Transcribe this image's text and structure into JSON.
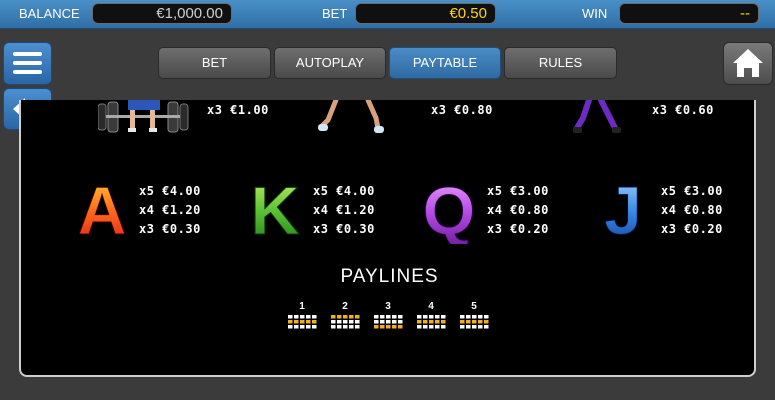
{
  "status_bar": {
    "balance_label": "BALANCE",
    "balance_value": "€1,000.00",
    "bet_label": "BET",
    "bet_value": "€0.50",
    "win_label": "WIN",
    "win_value": "--"
  },
  "tabs": [
    {
      "label": "BET",
      "active": false
    },
    {
      "label": "AUTOPLAY",
      "active": false
    },
    {
      "label": "PAYTABLE",
      "active": true
    },
    {
      "label": "RULES",
      "active": false
    }
  ],
  "icons": {
    "menu": "hamburger-menu-icon",
    "back": "arrow-left-icon",
    "home": "home-icon"
  },
  "paytable_top_row": [
    {
      "symbol": "weightlifter",
      "payout": "x3 €1.00"
    },
    {
      "symbol": "runner",
      "payout": "x3 €0.80"
    },
    {
      "symbol": "athlete-purple",
      "payout": "x3 €0.60"
    }
  ],
  "paytable_letters": [
    {
      "symbol": "A",
      "colors": [
        "#ffd23a",
        "#ff6a1a",
        "#e01818"
      ],
      "payouts": [
        "x5 €4.00",
        "x4 €1.20",
        "x3 €0.30"
      ]
    },
    {
      "symbol": "K",
      "colors": [
        "#c6f26a",
        "#5cc236",
        "#1f7a18"
      ],
      "payouts": [
        "x5 €4.00",
        "x4 €1.20",
        "x3 €0.30"
      ]
    },
    {
      "symbol": "Q",
      "colors": [
        "#f0a8ff",
        "#b64ee6",
        "#6b1a9a"
      ],
      "payouts": [
        "x5 €3.00",
        "x4 €0.80",
        "x3 €0.20"
      ]
    },
    {
      "symbol": "J",
      "colors": [
        "#a8d6ff",
        "#3a8ae6",
        "#123f9a"
      ],
      "payouts": [
        "x5 €3.00",
        "x4 €0.80",
        "x3 €0.20"
      ]
    }
  ],
  "paylines": {
    "title": "PAYLINES",
    "lines": [
      {
        "number": "1",
        "active_row": 1
      },
      {
        "number": "2",
        "active_row": 0
      },
      {
        "number": "3",
        "active_row": 2
      },
      {
        "number": "4",
        "active_row": 1
      },
      {
        "number": "5",
        "active_row": 1
      }
    ]
  },
  "colors": {
    "balance_text": "#cfcfcf",
    "bet_text": "#ffd700",
    "win_text": "#ffd700",
    "payline_active": "#f0b020",
    "payline_inactive": "#ffffff"
  }
}
